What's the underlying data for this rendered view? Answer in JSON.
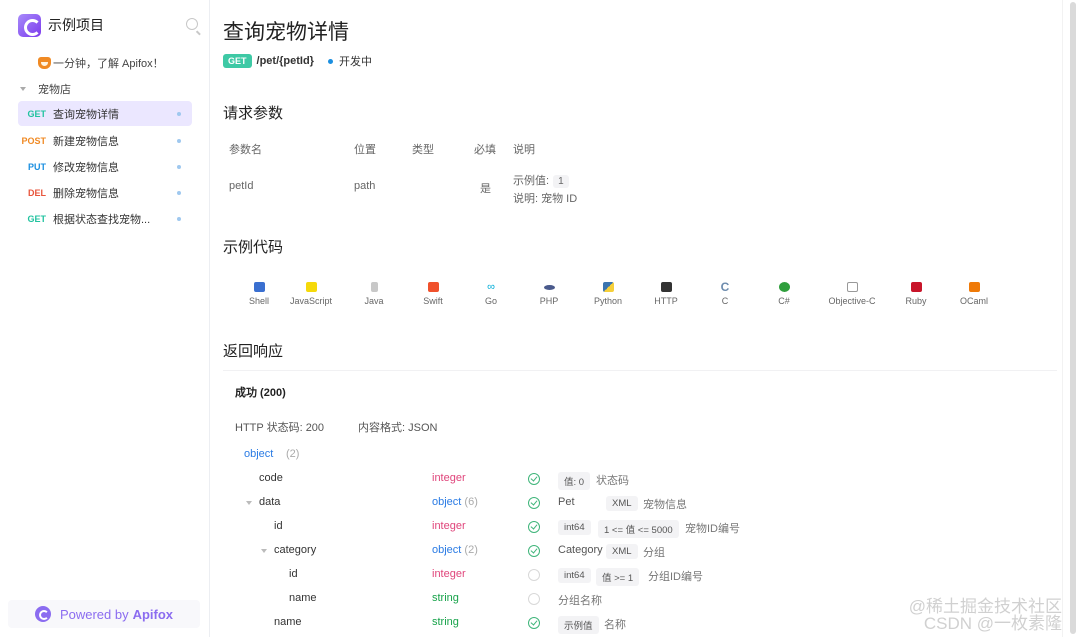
{
  "sidebar": {
    "project_title": "示例项目",
    "intro": "一分钟，了解 Apifox！",
    "folder": "宠物店",
    "items": [
      {
        "method": "GET",
        "label": "查询宠物详情"
      },
      {
        "method": "POST",
        "label": "新建宠物信息"
      },
      {
        "method": "PUT",
        "label": "修改宠物信息"
      },
      {
        "method": "DEL",
        "label": "删除宠物信息"
      },
      {
        "method": "GET",
        "label": "根据状态查找宠物..."
      }
    ],
    "powered_prefix": "Powered by",
    "powered_brand": "Apifox"
  },
  "main": {
    "title": "查询宠物详情",
    "method": "GET",
    "path": "/pet/{petId}",
    "status": "开发中",
    "req_section": "请求参数",
    "param_headers": [
      "参数名",
      "位置",
      "类型",
      "必填",
      "说明"
    ],
    "param_row": {
      "name": "petId",
      "location": "path",
      "required": "是",
      "example_label": "示例值:",
      "example_value": "1",
      "desc": "说明: 宠物 ID"
    },
    "code_section": "示例代码",
    "code_tabs": [
      "Shell",
      "JavaScript",
      "Java",
      "Swift",
      "Go",
      "PHP",
      "Python",
      "HTTP",
      "C",
      "C#",
      "Objective-C",
      "Ruby",
      "OCaml"
    ],
    "resp_section": "返回响应",
    "resp_tab": "成功 (200)",
    "resp_status": "HTTP 状态码: 200",
    "resp_format": "内容格式: JSON",
    "schema_root": "object",
    "schema_root_count": "(2)"
  },
  "watermark": {
    "line1": "@稀土掘金技术社区",
    "line2": "CSDN @一枚素隆"
  }
}
